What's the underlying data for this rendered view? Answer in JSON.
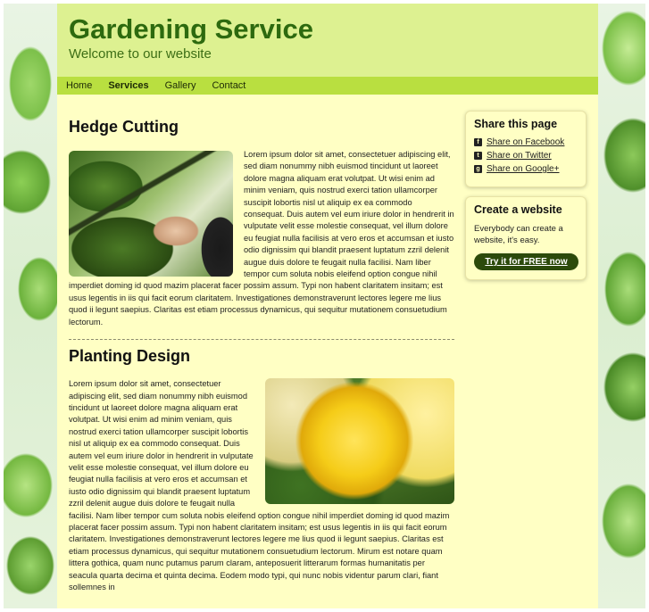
{
  "header": {
    "title": "Gardening Service",
    "tagline": "Welcome to our website"
  },
  "nav": {
    "items": [
      "Home",
      "Services",
      "Gallery",
      "Contact"
    ],
    "active": "Services"
  },
  "sections": [
    {
      "title": "Hedge Cutting",
      "image": "hedge-trimming-photo",
      "text": "Lorem ipsum dolor sit amet, consectetuer adipiscing elit, sed diam nonummy nibh euismod tincidunt ut laoreet dolore magna aliquam erat volutpat. Ut wisi enim ad minim veniam, quis nostrud exerci tation ullamcorper suscipit lobortis nisl ut aliquip ex ea commodo consequat. Duis autem vel eum iriure dolor in hendrerit in vulputate velit esse molestie consequat, vel illum dolore eu feugiat nulla facilisis at vero eros et accumsan et iusto odio dignissim qui blandit praesent luptatum zzril delenit augue duis dolore te feugait nulla facilisi. Nam liber tempor cum soluta nobis eleifend option congue nihil imperdiet doming id quod mazim placerat facer possim assum. Typi non habent claritatem insitam; est usus legentis in iis qui facit eorum claritatem. Investigationes demonstraverunt lectores legere me lius quod ii legunt saepius. Claritas est etiam processus dynamicus, qui sequitur mutationem consuetudium lectorum."
    },
    {
      "title": "Planting Design",
      "image": "yellow-rose-photo",
      "text": "Lorem ipsum dolor sit amet, consectetuer adipiscing elit, sed diam nonummy nibh euismod tincidunt ut laoreet dolore magna aliquam erat volutpat. Ut wisi enim ad minim veniam, quis nostrud exerci tation ullamcorper suscipit lobortis nisl ut aliquip ex ea commodo consequat. Duis autem vel eum iriure dolor in hendrerit in vulputate velit esse molestie consequat, vel illum dolore eu feugiat nulla facilisis at vero eros et accumsan et iusto odio dignissim qui blandit praesent luptatum zzril delenit augue duis dolore te feugait nulla facilisi. Nam liber tempor cum soluta nobis eleifend option congue nihil imperdiet doming id quod mazim placerat facer possim assum. Typi non habent claritatem insitam; est usus legentis in iis qui facit eorum claritatem. Investigationes demonstraverunt lectores legere me lius quod ii legunt saepius. Claritas est etiam processus dynamicus, qui sequitur mutationem consuetudium lectorum. Mirum est notare quam littera gothica, quam nunc putamus parum claram, anteposuerit litterarum formas humanitatis per seacula quarta decima et quinta decima. Eodem modo typi, qui nunc nobis videntur parum clari, fiant sollemnes in"
    }
  ],
  "sidebar": {
    "share": {
      "title": "Share this page",
      "links": [
        {
          "icon": "facebook-icon",
          "glyph": "f",
          "label": "Share on Facebook"
        },
        {
          "icon": "twitter-icon",
          "glyph": "t",
          "label": "Share on Twitter"
        },
        {
          "icon": "google-plus-icon",
          "glyph": "g",
          "label": "Share on Google+"
        }
      ]
    },
    "create": {
      "title": "Create a website",
      "text": "Everybody can create a website, it's easy.",
      "button": "Try it for FREE now"
    }
  },
  "colors": {
    "header_bg": "#ddf191",
    "nav_bg": "#b9df40",
    "content_bg": "#ffffc4",
    "title_green": "#2d6a0f",
    "button_bg": "#2c4a0b"
  }
}
